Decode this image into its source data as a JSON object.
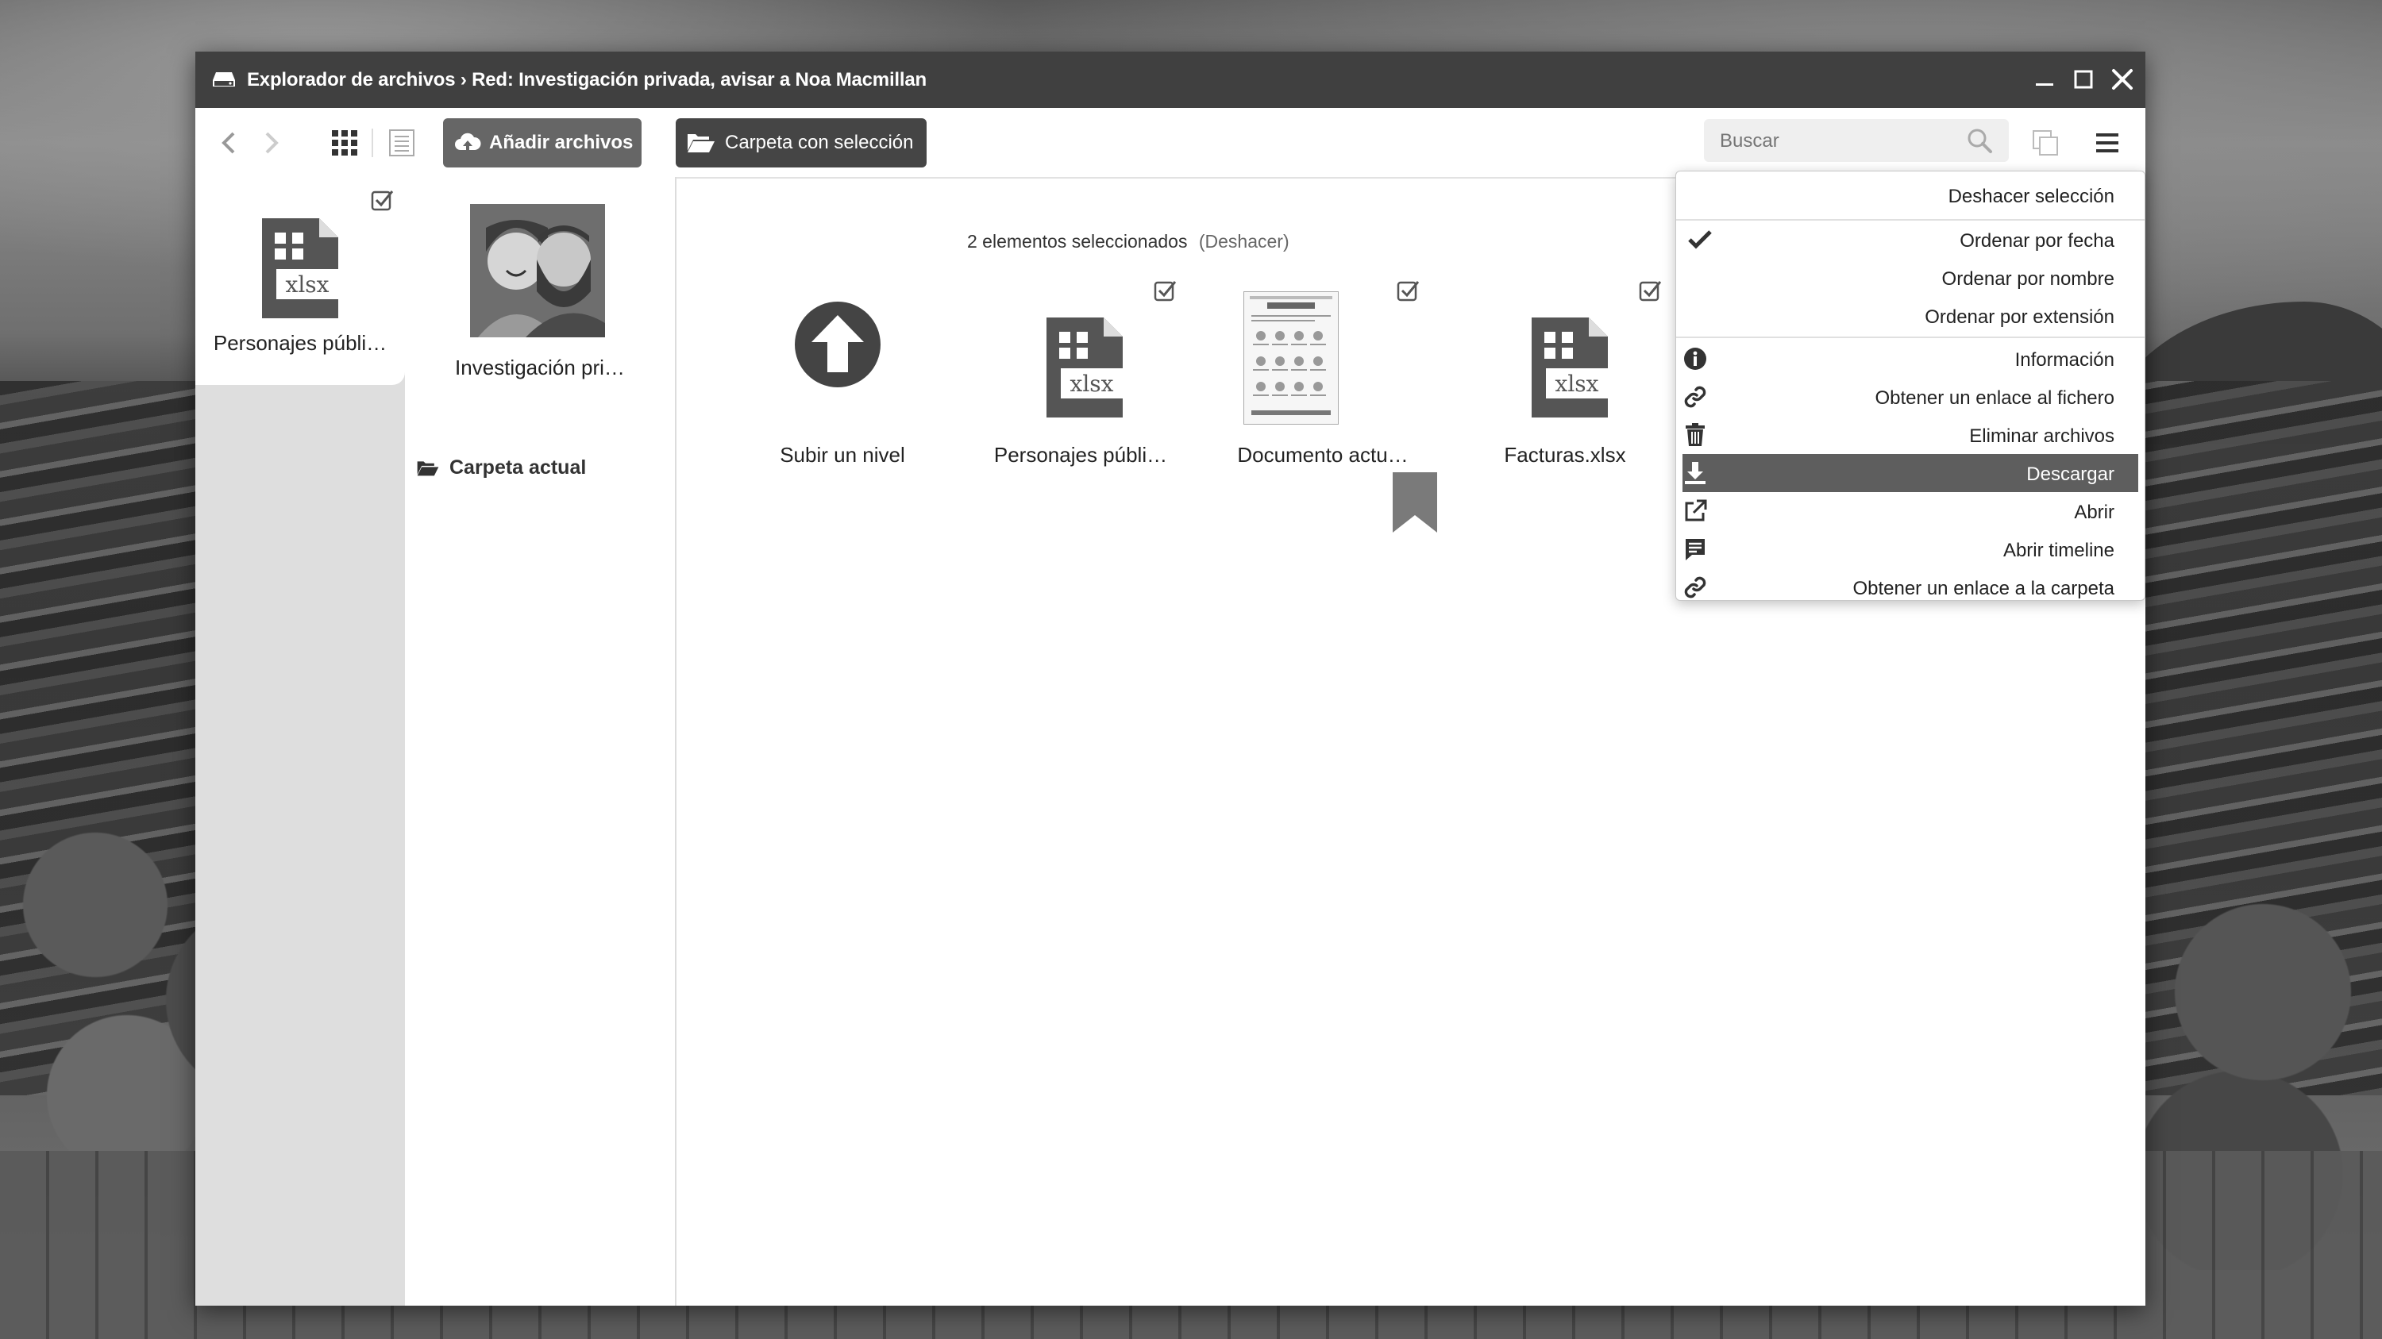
{
  "window": {
    "title": "Explorador de archivos › Red: Investigación privada, avisar a Noa Macmillan"
  },
  "toolbar": {
    "add_files_label": "Añadir archivos",
    "folder_selection_label": "Carpeta con selección",
    "search_placeholder": "Buscar"
  },
  "sidebar": {
    "selected_file": {
      "name": "Personajes públi…",
      "ext": "xlsx",
      "checked": true
    }
  },
  "panel": {
    "folder": {
      "name": "Investigación pri…"
    },
    "current_folder_label": "Carpeta actual"
  },
  "main": {
    "selection_status": "2 elementos seleccionados",
    "undo_label": "(Deshacer)",
    "items": [
      {
        "name": "Subir un nivel",
        "type": "up"
      },
      {
        "name": "Personajes públi…",
        "ext": "xlsx",
        "checked": true
      },
      {
        "name": "Documento actu…",
        "type": "document",
        "checked": true
      },
      {
        "name": "Facturas.xlsx",
        "ext": "xlsx",
        "checked": true
      }
    ]
  },
  "menu": {
    "items": [
      {
        "label": "Deshacer selección",
        "icon": ""
      },
      {
        "label": "Ordenar por fecha",
        "icon": "check-icon",
        "checked": true
      },
      {
        "label": "Ordenar por nombre",
        "icon": ""
      },
      {
        "label": "Ordenar por extensión",
        "icon": ""
      },
      {
        "label": "Información",
        "icon": "info-icon"
      },
      {
        "label": "Obtener un enlace al fichero",
        "icon": "link-icon"
      },
      {
        "label": "Eliminar archivos",
        "icon": "trash-icon"
      },
      {
        "label": "Descargar",
        "icon": "download-icon",
        "highlighted": true
      },
      {
        "label": "Abrir",
        "icon": "external-link-icon"
      },
      {
        "label": "Abrir timeline",
        "icon": "timeline-icon"
      },
      {
        "label": "Obtener un enlace a la carpeta",
        "icon": "link-icon"
      }
    ]
  }
}
